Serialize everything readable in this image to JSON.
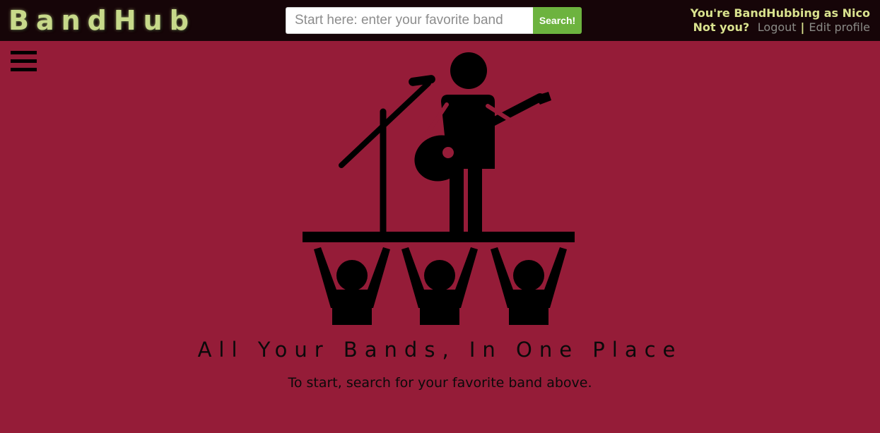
{
  "header": {
    "logo": "BandHub",
    "search": {
      "placeholder": "Start here: enter your favorite band",
      "value": "",
      "button_label": "Search!"
    },
    "user": {
      "greeting": "You're BandHubbing as Nico",
      "not_you": "Not you?",
      "logout_label": "Logout",
      "separator": "|",
      "edit_profile_label": "Edit profile"
    }
  },
  "menu": {
    "icon": "hamburger-menu-icon"
  },
  "hero": {
    "illustration": "concert-stage-icon",
    "tagline": "All Your Bands, In One Place",
    "instruction": "To start, search for your favorite band above."
  },
  "colors": {
    "background": "#951c38",
    "topbar": "#160508",
    "logo": "#c7d98a",
    "user_text": "#d9e28e",
    "link": "#8a8a86",
    "search_button": "#6db33f"
  }
}
